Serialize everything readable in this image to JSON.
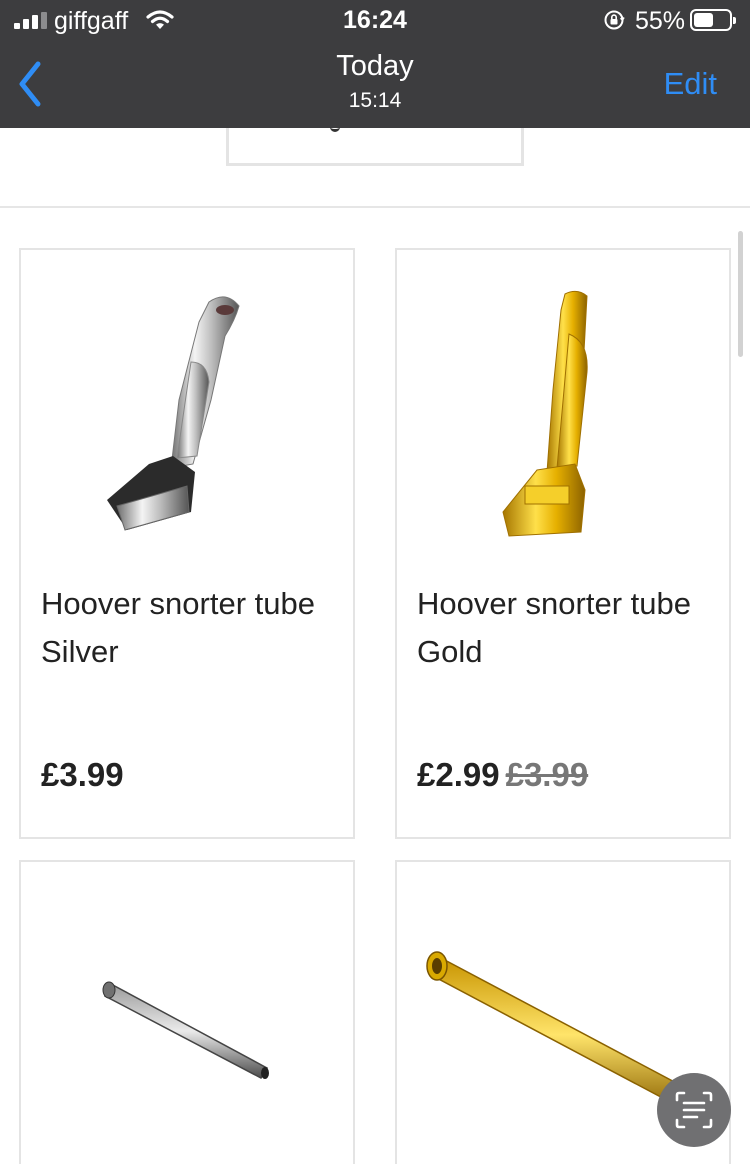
{
  "status_bar": {
    "carrier": "giffgaff",
    "time": "16:24",
    "battery_percent": "55%",
    "battery_level": 0.55
  },
  "nav_bar": {
    "title": "Today",
    "subtitle": "15:14",
    "edit_label": "Edit"
  },
  "products": [
    {
      "name": "Hoover snorter tube Silver",
      "price": "£3.99",
      "old_price": "",
      "image": "silver-hoover-tube"
    },
    {
      "name": "Hoover snorter tube Gold",
      "price": "£2.99",
      "old_price": "£3.99",
      "image": "gold-hoover-tube"
    },
    {
      "name": "",
      "price": "",
      "old_price": "",
      "image": "silver-straight-tube"
    },
    {
      "name": "",
      "price": "",
      "old_price": "",
      "image": "gold-straight-tube"
    }
  ],
  "icons": {
    "back": "chevron-left-icon",
    "scan": "text-scan-icon"
  },
  "colors": {
    "nav_bg": "#3d3d3f",
    "accent": "#2f8df5"
  }
}
